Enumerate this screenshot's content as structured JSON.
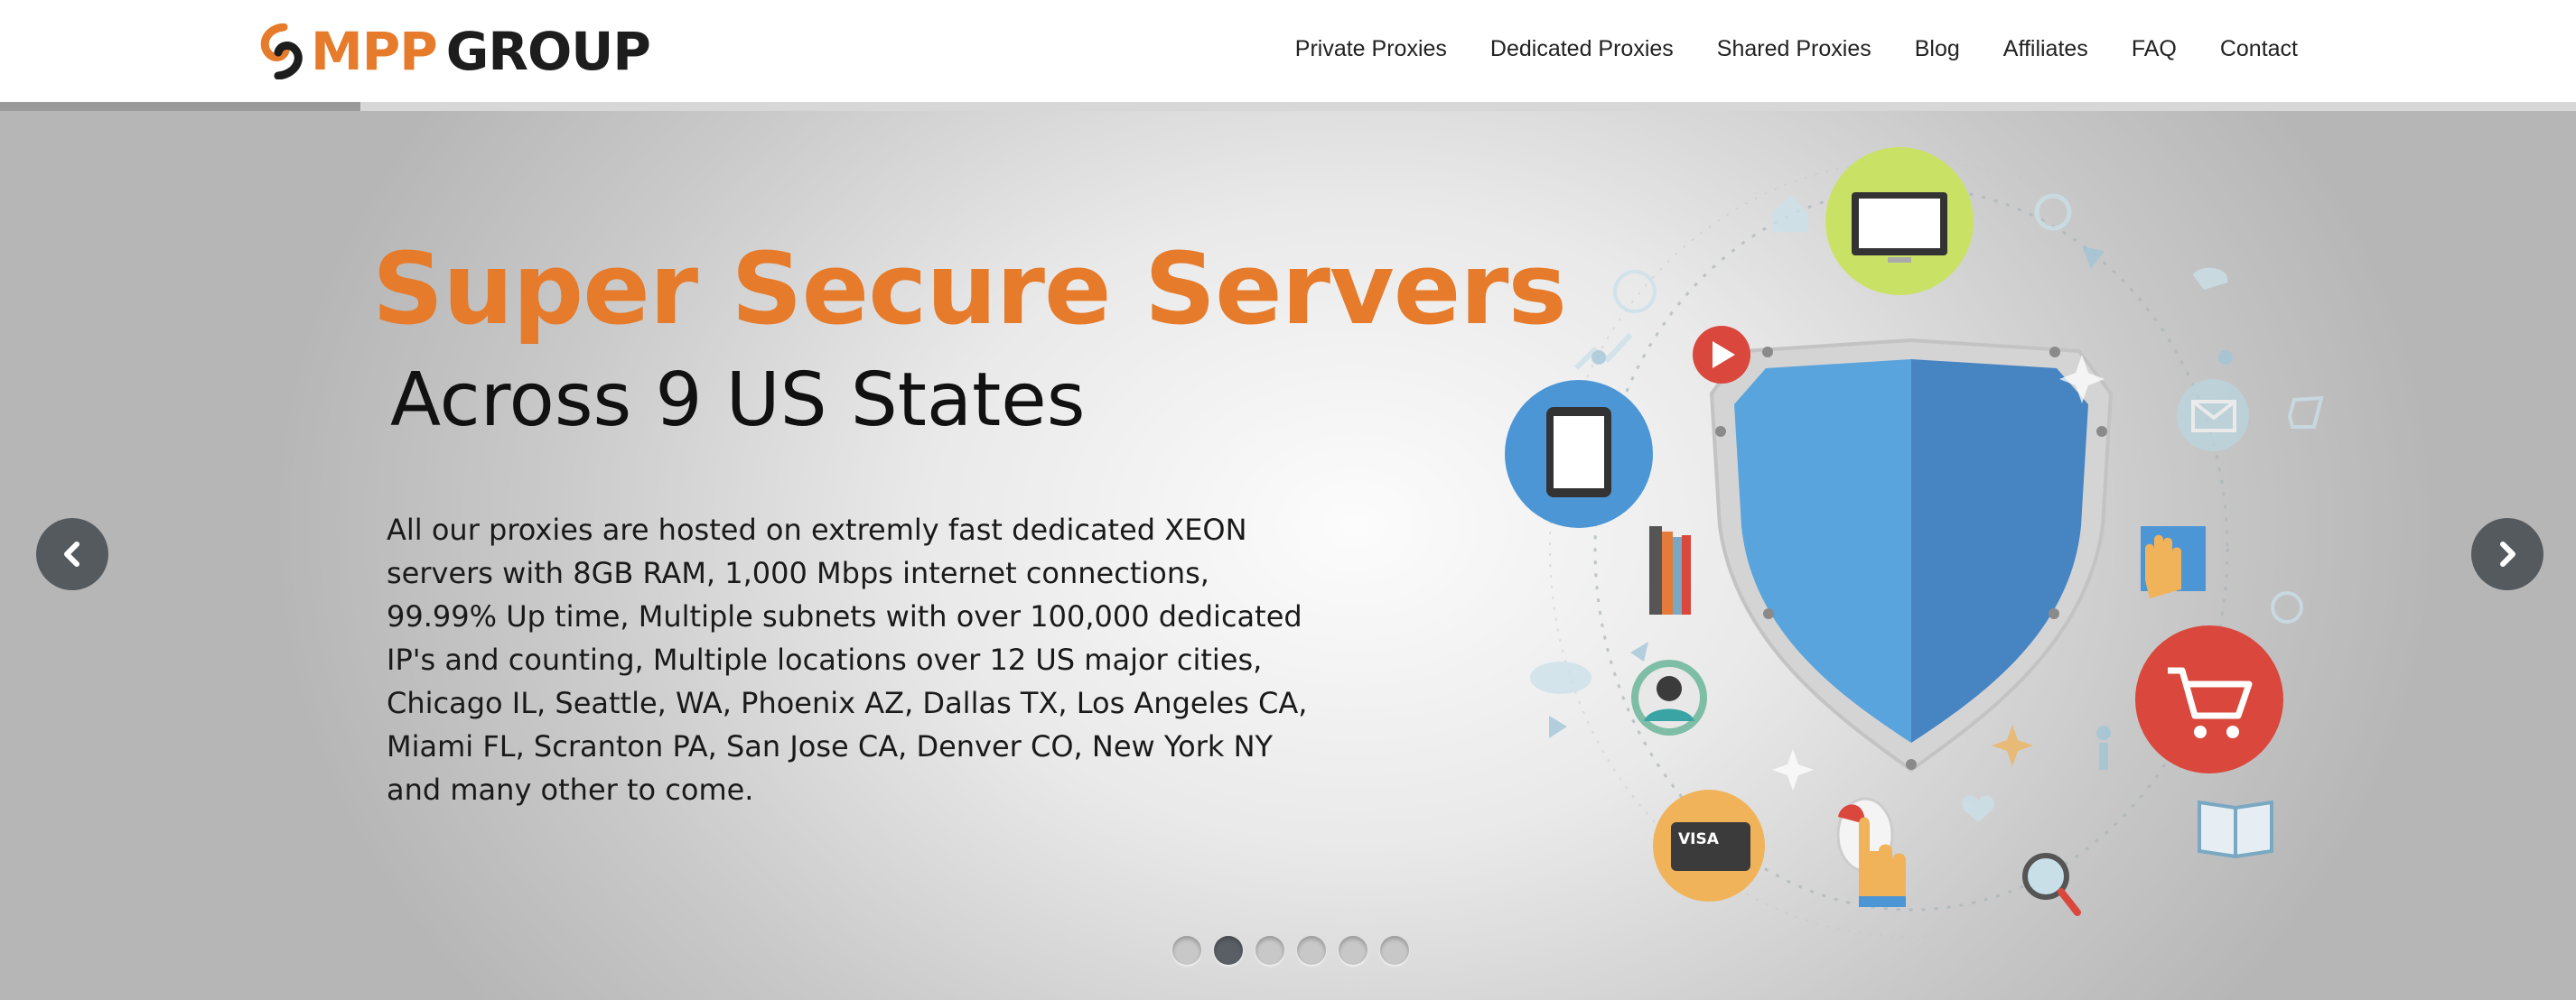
{
  "brand": {
    "logo_mpp": "MPP",
    "logo_group": "GROUP",
    "accent_color": "#e57b2b"
  },
  "nav": {
    "items": [
      "Private Proxies",
      "Dedicated Proxies",
      "Shared Proxies",
      "Blog",
      "Affiliates",
      "FAQ",
      "Contact"
    ]
  },
  "hero": {
    "title": "Super Secure Servers",
    "subtitle": "Across 9 US States",
    "description": "All our proxies are hosted on extremly fast dedicated XEON servers with 8GB RAM, 1,000 Mbps internet connections, 99.99% Up time, Multiple subnets with over 100,000 dedicated IP's and counting, Multiple locations over 12 US major cities, Chicago IL, Seattle, WA, Phoenix AZ, Dallas TX, Los Angeles CA, Miami FL, Scranton PA, San Jose CA, Denver CO, New York NY and many other to come.",
    "slide_progress": 0.14,
    "active_slide": 2,
    "slide_count": 6,
    "card_text": "VISA"
  },
  "icons": [
    "shield-icon",
    "monitor-icon",
    "tablet-icon",
    "cart-icon",
    "credit-card-icon",
    "search-icon",
    "mail-icon",
    "play-icon",
    "user-icon",
    "book-icon"
  ]
}
